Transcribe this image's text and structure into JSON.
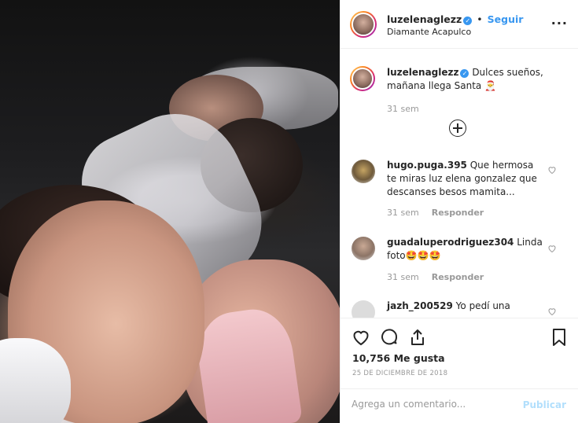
{
  "post": {
    "username": "luzelenaglezz",
    "follow_label": "Seguir",
    "location": "Diamante Acapulco",
    "more_label": "···"
  },
  "caption": {
    "username": "luzelenaglezz",
    "text": "Dulces sueños, mañana llega Santa 🎅",
    "time": "31 sem"
  },
  "comments": [
    {
      "username": "hugo.puga.395",
      "text": "Que hermosa te miras luz elena gonzalez que descanses besos mamita...",
      "time": "31 sem",
      "reply_label": "Responder"
    },
    {
      "username": "guadaluperodriguez304",
      "text": "Linda foto🤩🤩🤩",
      "time": "31 sem",
      "reply_label": "Responder"
    },
    {
      "username": "jazh_200529",
      "text": "Yo pedí una",
      "time": "",
      "reply_label": ""
    }
  ],
  "likes": {
    "count": "10,756",
    "label": "Me gusta"
  },
  "date": "25 DE DICIEMBRE DE 2018",
  "add_comment": {
    "placeholder": "Agrega un comentario...",
    "publish_label": "Publicar"
  },
  "colors": {
    "link": "#3897f0",
    "muted": "#999999",
    "publish_disabled": "#b2dffc",
    "verified": "#3897f0"
  },
  "icons": [
    "heart-icon",
    "comment-icon",
    "share-icon",
    "bookmark-icon",
    "plus-circle-icon",
    "more-icon",
    "verified-icon"
  ]
}
